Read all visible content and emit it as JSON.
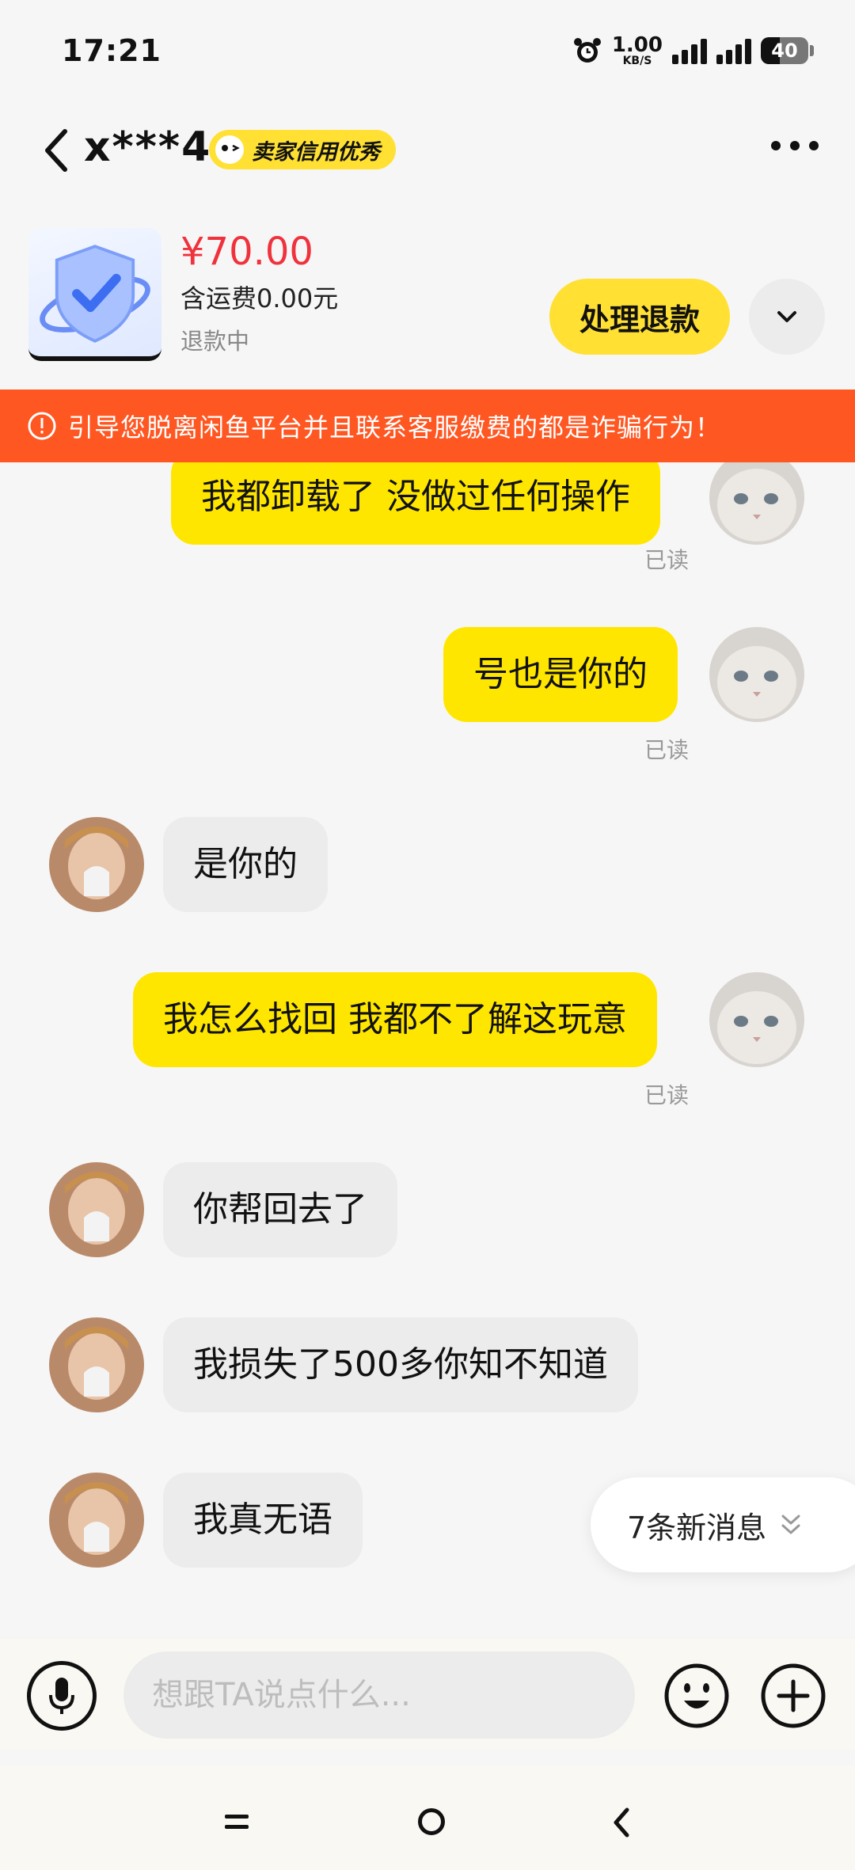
{
  "status_bar": {
    "time": "17:21",
    "net_speed_value": "1.00",
    "net_speed_unit": "KB/S",
    "battery": "40",
    "battery_level": 0.4
  },
  "header": {
    "title": "x***4",
    "badge": "卖家信用优秀"
  },
  "product": {
    "price": "¥70.00",
    "shipping": "含运费0.00元",
    "status": "退款中",
    "refund_button": "处理退款"
  },
  "warning": {
    "text": "引导您脱离闲鱼平台并且联系客服缴费的都是诈骗行为！"
  },
  "messages": [
    {
      "side": "me",
      "text": "我都卸载了 没做过任何操作",
      "read": "已读"
    },
    {
      "side": "me",
      "text": "号也是你的",
      "read": "已读"
    },
    {
      "side": "them",
      "text": "是你的"
    },
    {
      "side": "me",
      "text": "我怎么找回 我都不了解这玩意",
      "read": "已读"
    },
    {
      "side": "them",
      "text": "你帮回去了"
    },
    {
      "side": "them",
      "text": "我损失了500多你知不知道"
    },
    {
      "side": "them",
      "text": "我真无语"
    }
  ],
  "new_messages_pill": "7条新消息",
  "input": {
    "placeholder": "想跟TA说点什么..."
  },
  "colors": {
    "accent_yellow": "#ffe600",
    "warning_orange": "#ff5722",
    "price_red": "#f0323c"
  },
  "icons": [
    "back-icon",
    "more-icon",
    "chevron-down-icon",
    "warning-icon",
    "voice-icon",
    "emoji-icon",
    "plus-icon",
    "double-chevron-down-icon"
  ]
}
